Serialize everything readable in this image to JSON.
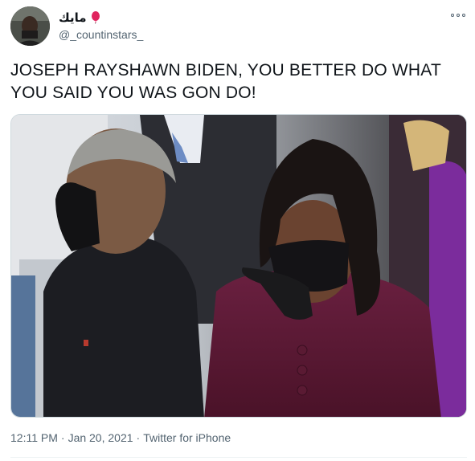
{
  "author": {
    "display_name": "مايك",
    "handle": "@_countinstars_",
    "avatar_icon": "profile-photo"
  },
  "tweet": {
    "text": "JOSEPH RAYSHAWN BIDEN, YOU BETTER DO WHAT YOU SAID YOU WAS GON DO!",
    "media_description_icon": "photo"
  },
  "meta": {
    "time": "12:11 PM",
    "separator": "·",
    "date": "Jan 20, 2021",
    "separator2": "·",
    "source": "Twitter for iPhone"
  },
  "colors": {
    "text": "#0f1419",
    "secondary": "#536471",
    "border": "#cfd9de",
    "coat": "#5a1a33"
  }
}
